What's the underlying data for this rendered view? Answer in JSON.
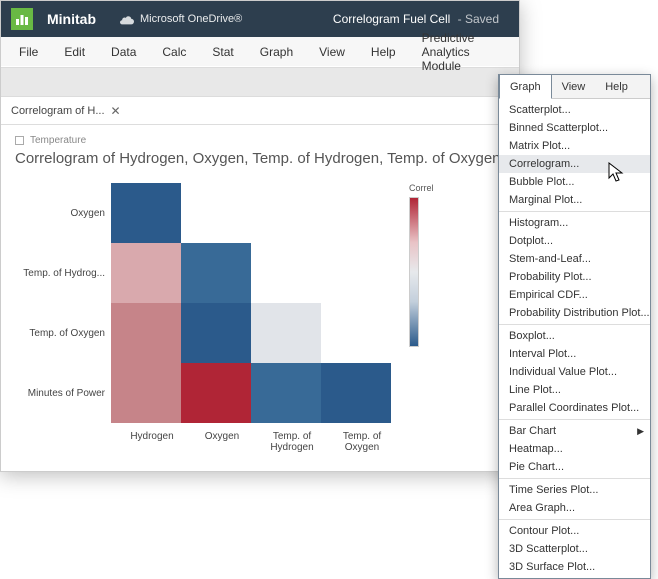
{
  "titlebar": {
    "brand": "Minitab",
    "onedrive": "Microsoft OneDrive®",
    "doc_title": "Correlogram Fuel Cell",
    "saved": " - Saved"
  },
  "menu": [
    "File",
    "Edit",
    "Data",
    "Calc",
    "Stat",
    "Graph",
    "View",
    "Help",
    "Predictive Analytics Module"
  ],
  "tab": {
    "label": "Correlogram of H...",
    "close": "✕"
  },
  "crumb": "Temperature",
  "chart_title": "Correlogram of Hydrogen, Oxygen, Temp. of Hydrogen, Temp. of Oxygen, Minutes of P",
  "legend_title": "Correl",
  "chart_data": {
    "type": "heatmap",
    "title": "Correlogram of Hydrogen, Oxygen, Temp. of Hydrogen, Temp. of Oxygen, Minutes of Power",
    "x_categories": [
      "Hydrogen",
      "Oxygen",
      "Temp. of Hydrogen",
      "Temp. of Oxygen"
    ],
    "y_categories": [
      "Oxygen",
      "Temp. of Hydrog...",
      "Temp. of Oxygen",
      "Minutes of Power"
    ],
    "color_scale": {
      "min": -1,
      "mid": 0,
      "max": 1,
      "low_color": "#2b5a8b",
      "mid_color": "#e7e9ec",
      "high_color": "#b02536"
    },
    "cells": [
      [
        -0.75,
        null,
        null,
        null
      ],
      [
        0.45,
        -0.7,
        null,
        null
      ],
      [
        0.55,
        -0.8,
        0.05,
        null
      ],
      [
        0.55,
        0.95,
        -0.7,
        -0.75
      ]
    ],
    "cell_colors": [
      [
        "#2b5a8b",
        "",
        "",
        ""
      ],
      [
        "#d9a9ad",
        "#386a97",
        "",
        ""
      ],
      [
        "#c68489",
        "#2b5a8b",
        "#e1e4e9",
        ""
      ],
      [
        "#c68489",
        "#b02536",
        "#386a97",
        "#2b5a8b"
      ]
    ]
  },
  "dropdown": {
    "menubar": [
      "Graph",
      "View",
      "Help"
    ],
    "active_index": 0,
    "groups": [
      [
        "Scatterplot...",
        "Binned Scatterplot...",
        "Matrix Plot...",
        "Correlogram...",
        "Bubble Plot...",
        "Marginal Plot..."
      ],
      [
        "Histogram...",
        "Dotplot...",
        "Stem-and-Leaf...",
        "Probability Plot...",
        "Empirical CDF...",
        "Probability Distribution Plot..."
      ],
      [
        "Boxplot...",
        "Interval Plot...",
        "Individual Value Plot...",
        "Line Plot...",
        "Parallel Coordinates Plot..."
      ],
      [
        "Bar Chart",
        "Heatmap...",
        "Pie Chart..."
      ],
      [
        "Time Series Plot...",
        "Area Graph..."
      ],
      [
        "Contour Plot...",
        "3D Scatterplot...",
        "3D Surface Plot..."
      ]
    ],
    "hover_item": "Correlogram...",
    "submenu_item": "Bar Chart"
  }
}
